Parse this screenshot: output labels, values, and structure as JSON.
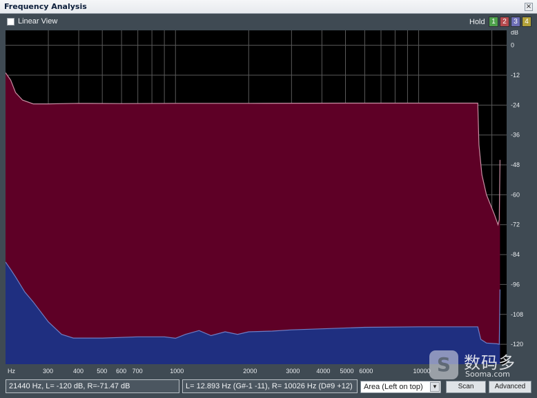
{
  "window": {
    "title": "Frequency Analysis",
    "close_label": "×"
  },
  "toolbar": {
    "linear_view_label": "Linear View",
    "linear_view_checked": false,
    "hold_label": "Hold",
    "hold_buttons": [
      {
        "label": "1",
        "color": "#4ea14b"
      },
      {
        "label": "2",
        "color": "#b54a4e"
      },
      {
        "label": "3",
        "color": "#6e6fb6"
      },
      {
        "label": "4",
        "color": "#b3a23a"
      }
    ]
  },
  "chart_data": {
    "type": "area",
    "title": "",
    "xlabel": "Hz",
    "ylabel": "dB",
    "x_scale": "log",
    "xlim": [
      200,
      23000
    ],
    "ylim": [
      -128,
      6
    ],
    "x_ticks": [
      {
        "value": 300,
        "label": "300"
      },
      {
        "value": 400,
        "label": "400"
      },
      {
        "value": 500,
        "label": "500"
      },
      {
        "value": 600,
        "label": "600"
      },
      {
        "value": 700,
        "label": "700"
      },
      {
        "value": 1000,
        "label": "1000"
      },
      {
        "value": 2000,
        "label": "2000"
      },
      {
        "value": 3000,
        "label": "3000"
      },
      {
        "value": 4000,
        "label": "4000"
      },
      {
        "value": 5000,
        "label": "5000"
      },
      {
        "value": 6000,
        "label": "6000"
      },
      {
        "value": 10000,
        "label": "10000"
      }
    ],
    "x_minor_gridlines": [
      800,
      900,
      7000,
      8000,
      9000,
      20000
    ],
    "y_ticks": [
      0,
      -12,
      -24,
      -36,
      -48,
      -60,
      -72,
      -84,
      -96,
      -108,
      -120
    ],
    "grid": true,
    "background": "#000000",
    "grid_color": "#5a5a5a",
    "series": [
      {
        "color": "#5e0026",
        "line_color": "#c98ea3",
        "points": [
          [
            200,
            -11
          ],
          [
            210,
            -14
          ],
          [
            220,
            -19
          ],
          [
            235,
            -22
          ],
          [
            260,
            -23.5
          ],
          [
            300,
            -23.5
          ],
          [
            400,
            -23.3
          ],
          [
            600,
            -23.4
          ],
          [
            1000,
            -23.3
          ],
          [
            2000,
            -23.3
          ],
          [
            5000,
            -23.2
          ],
          [
            10000,
            -23.2
          ],
          [
            17500,
            -23.2
          ],
          [
            17700,
            -40
          ],
          [
            18200,
            -52
          ],
          [
            19000,
            -60
          ],
          [
            20500,
            -68
          ],
          [
            21200,
            -72
          ],
          [
            21440,
            -70
          ],
          [
            21600,
            -46
          ]
        ]
      },
      {
        "color": "#1f2f80",
        "line_color": "#6f7ec4",
        "points": [
          [
            200,
            -87
          ],
          [
            210,
            -90
          ],
          [
            220,
            -93
          ],
          [
            240,
            -99
          ],
          [
            260,
            -103
          ],
          [
            300,
            -111
          ],
          [
            340,
            -116
          ],
          [
            380,
            -117.5
          ],
          [
            500,
            -117.5
          ],
          [
            700,
            -117
          ],
          [
            900,
            -117
          ],
          [
            1000,
            -117.6
          ],
          [
            1100,
            -116
          ],
          [
            1250,
            -114.5
          ],
          [
            1400,
            -116.5
          ],
          [
            1600,
            -115
          ],
          [
            1800,
            -116
          ],
          [
            2000,
            -115
          ],
          [
            2500,
            -114.7
          ],
          [
            3000,
            -114.2
          ],
          [
            4000,
            -113.8
          ],
          [
            6000,
            -113.2
          ],
          [
            10000,
            -113
          ],
          [
            17500,
            -113
          ],
          [
            18000,
            -118
          ],
          [
            19000,
            -119.5
          ],
          [
            21000,
            -119.8
          ],
          [
            21440,
            -120
          ],
          [
            21600,
            -98
          ]
        ]
      }
    ]
  },
  "status": {
    "cursor_readout": "21440 Hz, L=  -120 dB, R=-71.47 dB",
    "peak_readout": "L= 12.893 Hz (G#-1 -11), R=  10026 Hz (D#9 +12)",
    "display_mode": "Area (Left on top)",
    "scan_label": "Scan",
    "advanced_label": "Advanced"
  },
  "watermark": {
    "logo_letter": "S",
    "chinese_text": "数码多",
    "english_text": "Sooma.com"
  }
}
